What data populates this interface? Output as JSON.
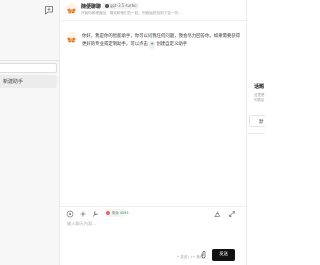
{
  "sidebar": {
    "new_chat_icon": "chat-plus-icon",
    "items": [
      {
        "label": "新建助手"
      }
    ]
  },
  "header": {
    "title": "随便聊聊",
    "model": "gpt-3.5-turbo",
    "description": "开始你和精度回，喜欢和他们在一起，但我始终找到了这一切..."
  },
  "messages": [
    {
      "role": "assistant",
      "text_before": "你好，我是你的智能助手，你可以问我任何问题，我会尽力回答你。如果需要获得更好的专业或定制助手，可以点击",
      "chip_icon": "+",
      "chip_text": "创建自定义助手"
    }
  ],
  "toolbar": {
    "icons": [
      "settings-circle-icon",
      "plus-icon",
      "tool-icon",
      "clean-icon",
      "expand-icon"
    ],
    "token_label": "剩余",
    "token_count": "4096"
  },
  "input": {
    "placeholder": "输入聊天内容...",
    "hint": "↵ 发送 / ⇧↵ 换行",
    "send_label": "发送"
  },
  "right_panel": {
    "title": "话题",
    "subtitle": "这里是话题列表区",
    "card_label": "默"
  }
}
